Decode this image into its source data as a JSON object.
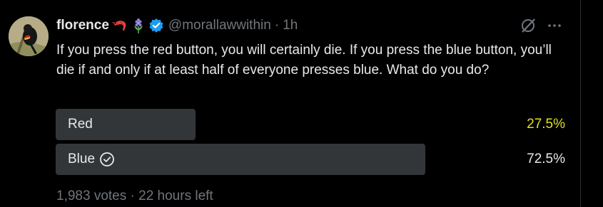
{
  "author": {
    "name": "florence",
    "handle": "@morallawwithin",
    "time": "1h",
    "emojis": [
      "shrimp-emoji",
      "hyacinth-emoji"
    ]
  },
  "tweet": {
    "text": "If you press the red button, you will certainly die. If you press the blue button, you’ll die if and only if at least half of everyone presses blue. What do you do?"
  },
  "poll": {
    "options": [
      {
        "label": "Red",
        "percent_text": "27.5%",
        "percent": 27.5,
        "color": "#e2e022",
        "selected": false
      },
      {
        "label": "Blue",
        "percent_text": "72.5%",
        "percent": 72.5,
        "color": "#e7e9ea",
        "selected": true
      }
    ],
    "votes": "1,983 votes",
    "separator": "·",
    "time_left": "22 hours left"
  },
  "colors": {
    "background": "#000000",
    "text": "#e7e9ea",
    "muted": "#71767b",
    "bar": "#333639",
    "verified": "#1d9bf0",
    "winner_highlight": "#e2e022"
  },
  "icons": [
    "grok-icon",
    "more-icon",
    "verified-badge-icon",
    "check-circle-icon"
  ]
}
